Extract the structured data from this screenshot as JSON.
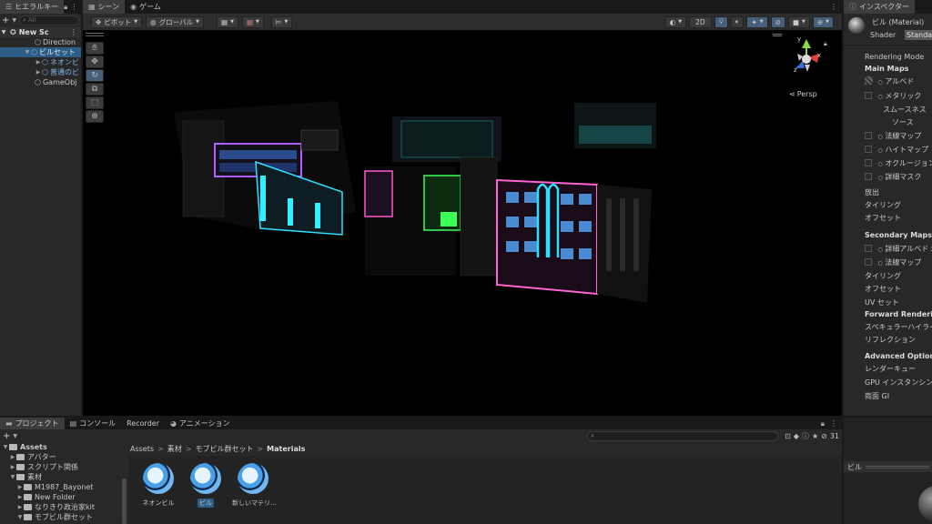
{
  "hierarchy": {
    "tab_label": "ヒエラルキー",
    "search_placeholder": "All",
    "scene_name": "New Sc",
    "items": [
      {
        "label": "Direction"
      },
      {
        "label": "ビルセット"
      },
      {
        "label": "ネオンビ"
      },
      {
        "label": "普通のビ"
      },
      {
        "label": "GameObj"
      }
    ]
  },
  "scene": {
    "tabs": [
      {
        "label": "シーン"
      },
      {
        "label": "ゲーム"
      }
    ],
    "pivot_label": "ピボット",
    "global_label": "グローバル",
    "mode_2d_label": "2D",
    "persp_label": "Persp"
  },
  "inspector": {
    "tab_label": "インスペクター",
    "material_name": "ビル (Material)",
    "shader_label": "Shader",
    "shader_value": "Standa",
    "rendering_mode_label": "Rendering Mode",
    "main_maps_header": "Main Maps",
    "albedo": "アルベド",
    "metallic": "メタリック",
    "smoothness": "スムースネス",
    "source": "ソース",
    "normal_map": "法線マップ",
    "height_map": "ハイトマップ",
    "occlusion": "オクルージョン",
    "detail_mask": "詳細マスク",
    "emission": "放出",
    "tiling": "タイリング",
    "offset": "オフセット",
    "secondary_maps_header": "Secondary Maps",
    "detail_albedo": "詳細アルベド x",
    "normal_map_2": "法線マップ",
    "tiling_2": "タイリング",
    "offset_2": "オフセット",
    "uv_set": "UV セット",
    "forward_rendering_header": "Forward Renderi",
    "specular_highlights": "スペキュラーハイライト",
    "reflections": "リフレクション",
    "advanced_header": "Advanced Option",
    "render_queue": "レンダーキュー",
    "gpu_instancing": "GPU インスタンシングを",
    "double_sided_gi": "両面 GI",
    "preview_label": "ビル"
  },
  "bottom": {
    "tabs": [
      {
        "label": "プロジェクト"
      },
      {
        "label": "コンソール"
      },
      {
        "label": "Recorder"
      },
      {
        "label": "アニメーション"
      }
    ],
    "hidden_count": "31",
    "tree": [
      {
        "label": "Assets"
      },
      {
        "label": "アバター"
      },
      {
        "label": "スクリプト関係"
      },
      {
        "label": "素材"
      },
      {
        "label": "M1987_Bayonet"
      },
      {
        "label": "New Folder"
      },
      {
        "label": "なりきり政治家kit"
      },
      {
        "label": "モブビル群セット"
      }
    ],
    "breadcrumb": [
      "Assets",
      "素材",
      "モブビル群セット",
      "Materials"
    ],
    "assets": [
      {
        "label": "ネオンビル"
      },
      {
        "label": "ビル"
      },
      {
        "label": "新しいマテリ..."
      }
    ]
  }
}
